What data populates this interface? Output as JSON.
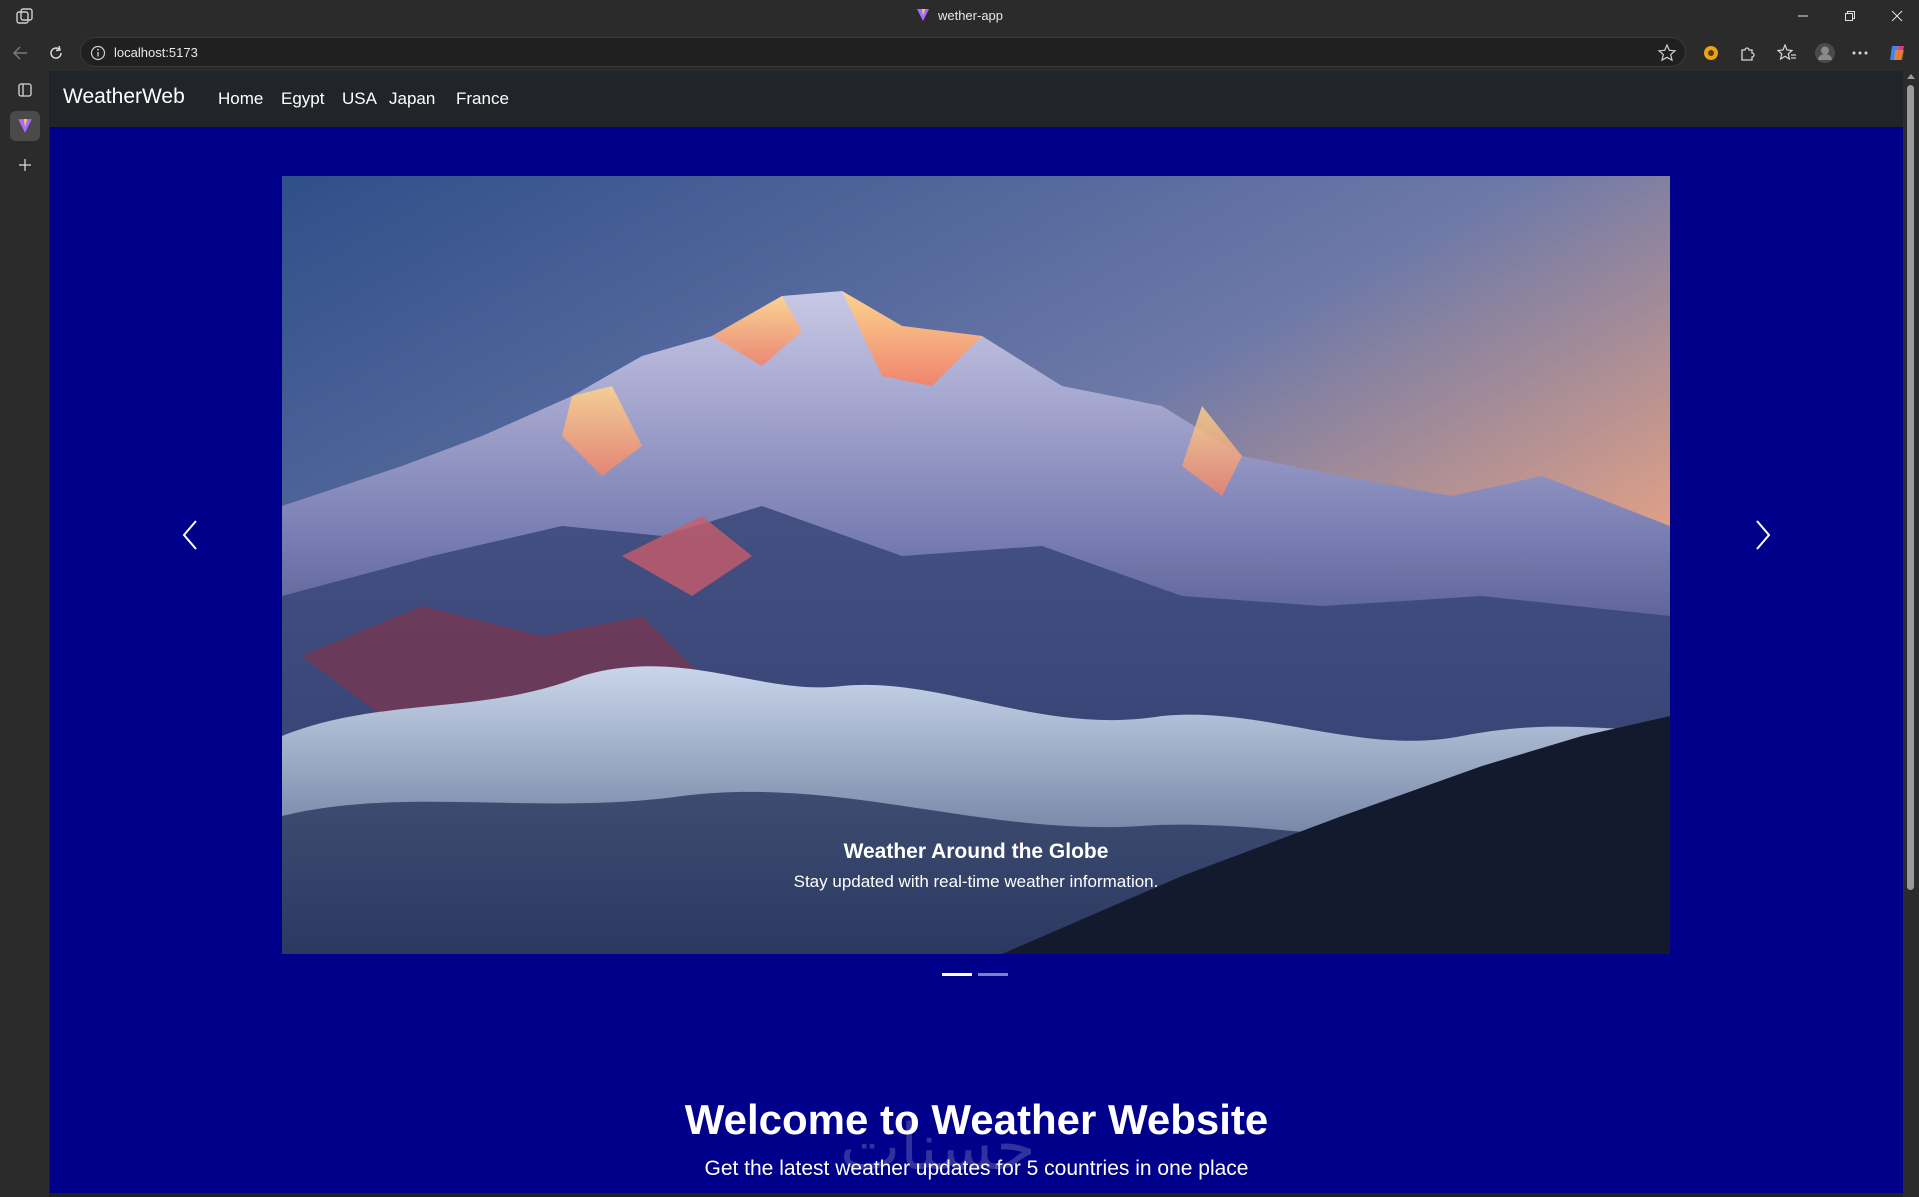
{
  "browser": {
    "tab_title": "wether-app",
    "url": "localhost:5173",
    "icons": {
      "workspaces": "workspaces-icon",
      "back": "back-arrow-icon",
      "refresh": "refresh-icon",
      "info": "site-info-icon",
      "favorite": "star-icon",
      "extension_1": "copilot-extension-icon",
      "extension_2": "extensions-puzzle-icon",
      "favorites": "favorites-icon",
      "profile": "profile-avatar",
      "more": "more-dots-icon",
      "copilot": "copilot-icon"
    },
    "window_controls": [
      "minimize",
      "restore",
      "close"
    ]
  },
  "navbar": {
    "brand": "WeatherWeb",
    "links": [
      "Home",
      "Egypt",
      "USA",
      "Japan",
      "France"
    ],
    "bg_color": "#212529"
  },
  "carousel": {
    "caption_title": "Weather Around the Globe",
    "caption_text": "Stay updated with real-time weather information.",
    "slide_count": 2,
    "active_slide": 1
  },
  "hero": {
    "title": "Welcome to Weather Website",
    "subtitle": "Get the latest weather updates for 5 countries in one place",
    "watermark": "حسنات"
  },
  "colors": {
    "page_bg": "#00008b",
    "text": "#ffffff"
  }
}
